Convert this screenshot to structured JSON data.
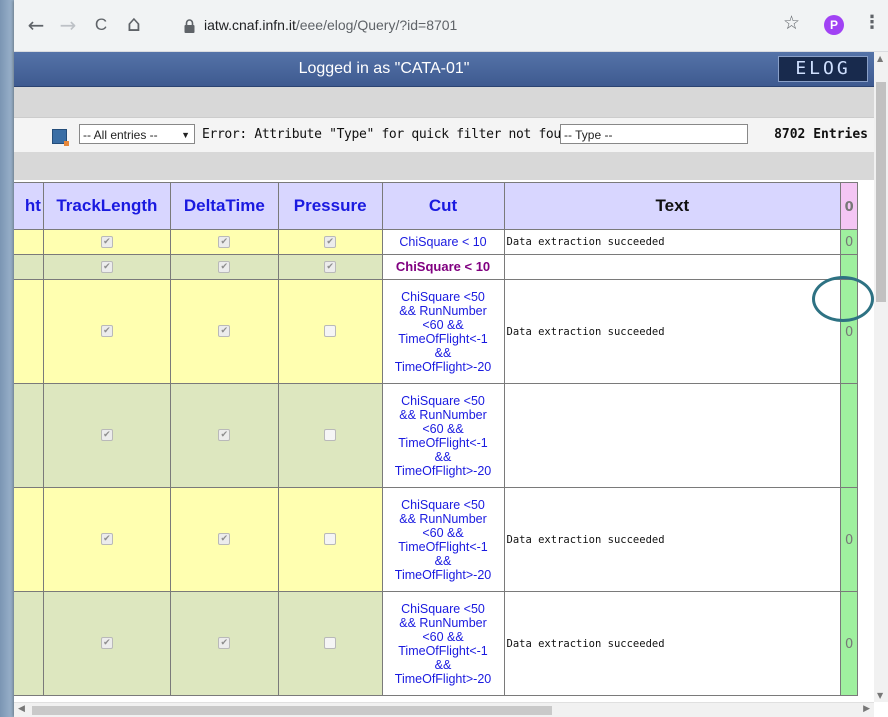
{
  "browser": {
    "url_host": "iatw.cnaf.infn.it",
    "url_path": "/eee/elog/Query/?id=8701",
    "profile_initial": "P"
  },
  "header": {
    "logged_in": "Logged in as \"CATA-01\"",
    "logo": "ELOG"
  },
  "filter": {
    "entries_select": "-- All entries --",
    "error": "Error: Attribute \"Type\" for quick filter not found",
    "type_select": "-- Type --",
    "count": "8702 Entries"
  },
  "table": {
    "columns": [
      "ht",
      "TrackLength",
      "DeltaTime",
      "Pressure",
      "Cut",
      "Text"
    ],
    "rows": [
      {
        "cut": "ChiSquare < 10",
        "text": "Data extraction succeeded",
        "checks": [
          true,
          true,
          true
        ],
        "attachment": true
      },
      {
        "cut": "ChiSquare < 10",
        "text": "",
        "checks": [
          true,
          true,
          true
        ],
        "attachment": false
      },
      {
        "cut_lines": [
          "ChiSquare <50",
          "&& RunNumber",
          "<60 &&",
          "TimeOfFlight<-1",
          "&&",
          "TimeOfFlight>-20"
        ],
        "text": "Data extraction succeeded",
        "checks": [
          true,
          true,
          false
        ],
        "attachment": true
      },
      {
        "cut_lines": [
          "ChiSquare <50",
          "&& RunNumber",
          "<60 &&",
          "TimeOfFlight<-1",
          "&&",
          "TimeOfFlight>-20"
        ],
        "text": "",
        "checks": [
          true,
          true,
          false
        ],
        "attachment": false
      },
      {
        "cut_lines": [
          "ChiSquare <50",
          "&& RunNumber",
          "<60 &&",
          "TimeOfFlight<-1",
          "&&",
          "TimeOfFlight>-20"
        ],
        "text": "Data extraction succeeded",
        "checks": [
          true,
          true,
          false
        ],
        "attachment": true
      },
      {
        "cut_lines": [
          "ChiSquare <50",
          "&& RunNumber",
          "<60 &&",
          "TimeOfFlight<-1",
          "&&",
          "TimeOfFlight>-20"
        ],
        "text": "Data extraction succeeded",
        "checks": [
          true,
          true,
          false
        ],
        "attachment": true
      }
    ]
  },
  "icons": {
    "back": "←",
    "forward": "→",
    "reload": "C",
    "home": "⌂",
    "star": "☆",
    "menu": "⋮",
    "clip": "0"
  },
  "colors": {
    "header_blue": "#3e5a90",
    "row_yellow": "#ffffb0",
    "row_green": "#dde7bf",
    "attach_green": "#9ff09f",
    "cut_blue": "#1a1ae0",
    "cut_purple": "#800080",
    "annotation": "#2e7283"
  }
}
